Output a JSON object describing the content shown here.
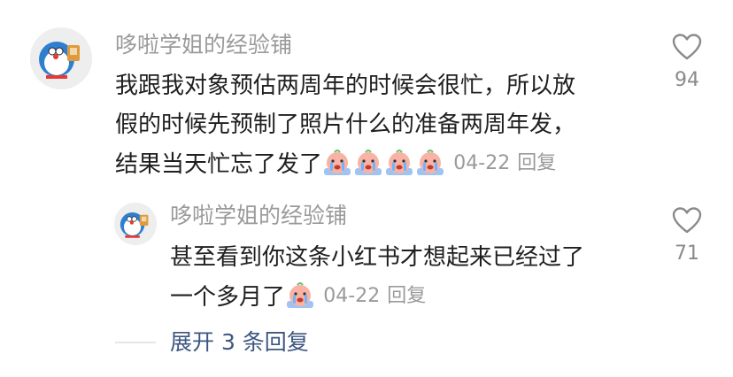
{
  "comment": {
    "username": "哆啦学姐的经验铺",
    "lines": [
      "我跟我对象预估两周年的时候会很忙，所以放",
      "假的时候先预制了照片什么的准备两周年发，",
      "结果当天忙忘了发了"
    ],
    "emoji_name": "crying-face-emoji",
    "date": "04-22",
    "reply_label": "回复",
    "like_count": "94"
  },
  "reply": {
    "username": "哆啦学姐的经验铺",
    "lines": [
      "甚至看到你这条小红书才想起来已经过了",
      "一个多月了"
    ],
    "emoji_name": "crying-face-emoji",
    "date": "04-22",
    "reply_label": "回复",
    "like_count": "71"
  },
  "expand_label": "展开 3 条回复",
  "colors": {
    "username": "#9a9a9a",
    "text": "#1f1f1f",
    "link": "#3e5680",
    "icon": "#8a8a8a"
  }
}
